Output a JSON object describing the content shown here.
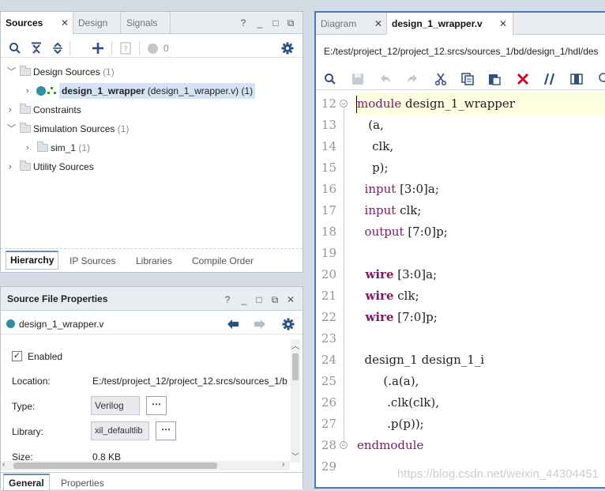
{
  "sources_panel": {
    "tabs": [
      "Sources",
      "Design",
      "Signals"
    ],
    "window_buttons": [
      "?",
      "_",
      "□",
      "⧉"
    ],
    "toolbar": {
      "badge_count": "0"
    },
    "tree": [
      {
        "label": "Design Sources",
        "count": "(1)"
      },
      {
        "label": "design_1_wrapper",
        "detail": "(design_1_wrapper.v) (1)"
      },
      {
        "label": "Constraints"
      },
      {
        "label": "Simulation Sources",
        "count": "(1)"
      },
      {
        "label": "sim_1",
        "count": "(1)"
      },
      {
        "label": "Utility Sources"
      }
    ],
    "bottom_tabs": [
      "Hierarchy",
      "IP Sources",
      "Libraries",
      "Compile Order"
    ]
  },
  "props_panel": {
    "title": "Source File Properties",
    "file_name": "design_1_wrapper.v",
    "enabled_label": "Enabled",
    "location_label": "Location:",
    "location_value": "E:/test/project_12/project_12.srcs/sources_1/b",
    "type_label": "Type:",
    "type_value": "Verilog",
    "library_label": "Library:",
    "library_value": "xil_defaultlib",
    "size_label": "Size:",
    "size_value": "0.8 KB",
    "dots": "⋯",
    "bottom_tabs": [
      "General",
      "Properties"
    ]
  },
  "editor": {
    "tabs": [
      "Diagram",
      "design_1_wrapper.v"
    ],
    "path": "E:/test/project_12/project_12.srcs/sources_1/bd/design_1/hdl/des",
    "line_numbers": [
      "12",
      "13",
      "14",
      "15",
      "16",
      "17",
      "18",
      "19",
      "20",
      "21",
      "22",
      "23",
      "24",
      "25",
      "26",
      "27",
      "28",
      "29"
    ],
    "lines": {
      "l12a": "module",
      "l12b": " design_1_wrapper",
      "l13": "   (a,",
      "l14": "    clk,",
      "l15": "    p);",
      "l16a": "  input",
      "l16b": " [3:0]a;",
      "l17a": "  input",
      "l17b": " clk;",
      "l18a": "  output",
      "l18b": " [7:0]p;",
      "l20a": "  wire",
      "l20b": " [3:0]a;",
      "l21a": "  wire",
      "l21b": " clk;",
      "l22a": "  wire",
      "l22b": " [7:0]p;",
      "l24": "  design_1 design_1_i",
      "l25": "       (.a(a),",
      "l26": "        .clk(clk),",
      "l27": "        .p(p));",
      "l28": "endmodule"
    },
    "watermark": "https://blog.csdn.net/weixin_44304451"
  },
  "colors": {
    "accent": "#2a6db5",
    "keyword": "#7d1a6b",
    "selection": "#d4e4f7",
    "current_line": "#fdfde0",
    "close_red": "#d0021b"
  }
}
